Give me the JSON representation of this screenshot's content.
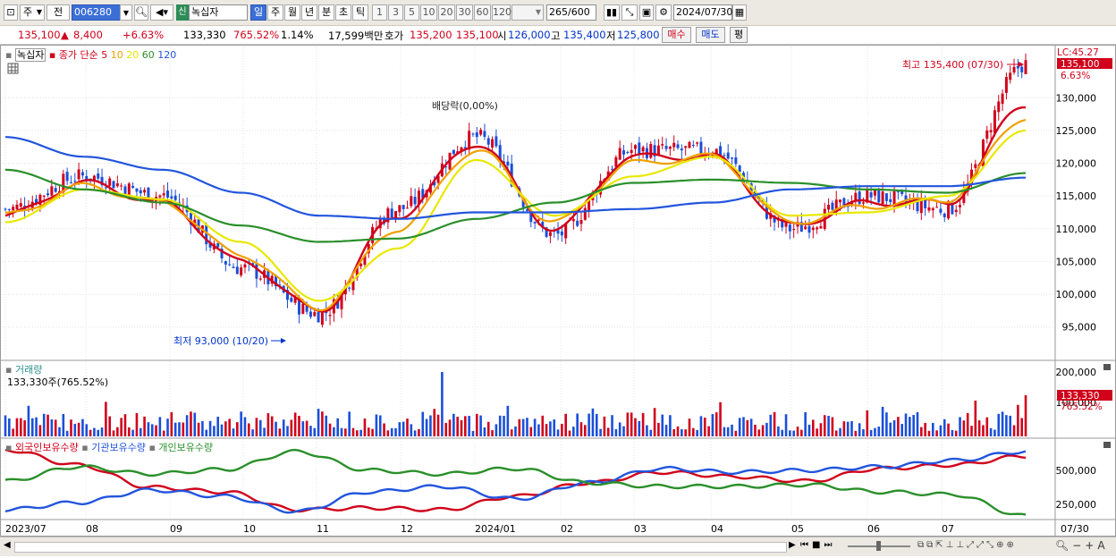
{
  "toolbar": {
    "chart_type": "주",
    "prev_label": "전",
    "stock_code": "006280",
    "badge": "신",
    "stock_name": "녹십자",
    "periods": [
      "일",
      "주",
      "월",
      "년",
      "분",
      "초",
      "틱"
    ],
    "selected_period": "일",
    "intervals": [
      "1",
      "3",
      "5",
      "10",
      "20",
      "30",
      "60",
      "120"
    ],
    "count_value": "265",
    "count_total": "/600",
    "date": "2024/07/30"
  },
  "quote": {
    "price": "135,100",
    "arrow": "▲",
    "change": "8,400",
    "change_pct": "+6.63%",
    "volume": "133,330",
    "vol_ratio": "765.52%",
    "turnover_pct": "1.14%",
    "amount": "17,599백만",
    "ask_label": "호가",
    "ask": "135,200",
    "bid": "135,100",
    "open_label": "시",
    "open": "126,000",
    "high_label": "고",
    "high": "135,400",
    "low_label": "저",
    "low": "125,800",
    "buy_label": "매수",
    "sell_label": "매도",
    "eval_label": "평"
  },
  "legend": {
    "name": "녹십자",
    "ma_label": "종가 단순",
    "ma_periods": [
      "5",
      "10",
      "20",
      "60",
      "120"
    ],
    "ma_colors": [
      "#d0021b",
      "#f0a000",
      "#e8e800",
      "#2a8f2a",
      "#2255dd"
    ],
    "volume_label": "거래량",
    "volume_value": "133,330주(765.52%)",
    "holdings": [
      "외국인보유수량",
      "기관보유수량",
      "개인보유수량"
    ],
    "holdings_colors": [
      "#d0021b",
      "#2255dd",
      "#2a8f2a"
    ]
  },
  "annotations": {
    "high": "최고 135,400 (07/30)",
    "low": "최저 93,000 (10/20)",
    "dividend": "배당락(0,00%)",
    "price_box_top": "LC:45.27",
    "price_box": "135,100",
    "price_box_pct": "6.63%",
    "vol_box": "133,330",
    "vol_box_pct": "765.52%"
  },
  "axes": {
    "price_ticks": [
      "130,000",
      "125,000",
      "120,000",
      "115,000",
      "110,000",
      "105,000",
      "100,000",
      "95,000"
    ],
    "volume_ticks": [
      "200,000",
      "100,000"
    ],
    "holdings_ticks": [
      "500,000",
      "250,000"
    ],
    "x_labels": [
      "2023/07",
      "08",
      "09",
      "10",
      "11",
      "12",
      "2024/01",
      "02",
      "03",
      "04",
      "05",
      "06",
      "07",
      "07/30"
    ]
  },
  "chart_data": {
    "type": "line",
    "title": "",
    "x": [
      "2023/07",
      "08",
      "09",
      "10",
      "11",
      "12",
      "2024/01",
      "02",
      "03",
      "04",
      "05",
      "06",
      "07",
      "07/30"
    ],
    "series": [
      {
        "name": "종가",
        "values": [
          113000,
          118000,
          115000,
          104000,
          97000,
          113000,
          124000,
          109000,
          122000,
          122000,
          110000,
          115000,
          113000,
          135100
        ]
      },
      {
        "name": "5",
        "values": [
          112000,
          117000,
          114000,
          105000,
          97500,
          112000,
          123000,
          110000,
          121000,
          121000,
          110500,
          114000,
          114000,
          129000
        ]
      },
      {
        "name": "10",
        "values": [
          112000,
          116500,
          114000,
          106000,
          98000,
          110000,
          122000,
          111000,
          120000,
          121000,
          111000,
          113500,
          114500,
          127000
        ]
      },
      {
        "name": "20",
        "values": [
          111000,
          116000,
          114500,
          108000,
          99000,
          107000,
          120500,
          112000,
          118000,
          121000,
          112000,
          112500,
          115000,
          125000
        ]
      },
      {
        "name": "60",
        "values": [
          119000,
          116000,
          114000,
          110500,
          108000,
          108500,
          111500,
          114000,
          117000,
          117500,
          117000,
          116000,
          115500,
          118500
        ]
      },
      {
        "name": "120",
        "values": [
          124000,
          121000,
          119000,
          115500,
          112000,
          111500,
          112500,
          112500,
          113000,
          114000,
          116000,
          116500,
          116500,
          117800
        ]
      }
    ],
    "ylim": [
      91000,
      137000
    ]
  }
}
